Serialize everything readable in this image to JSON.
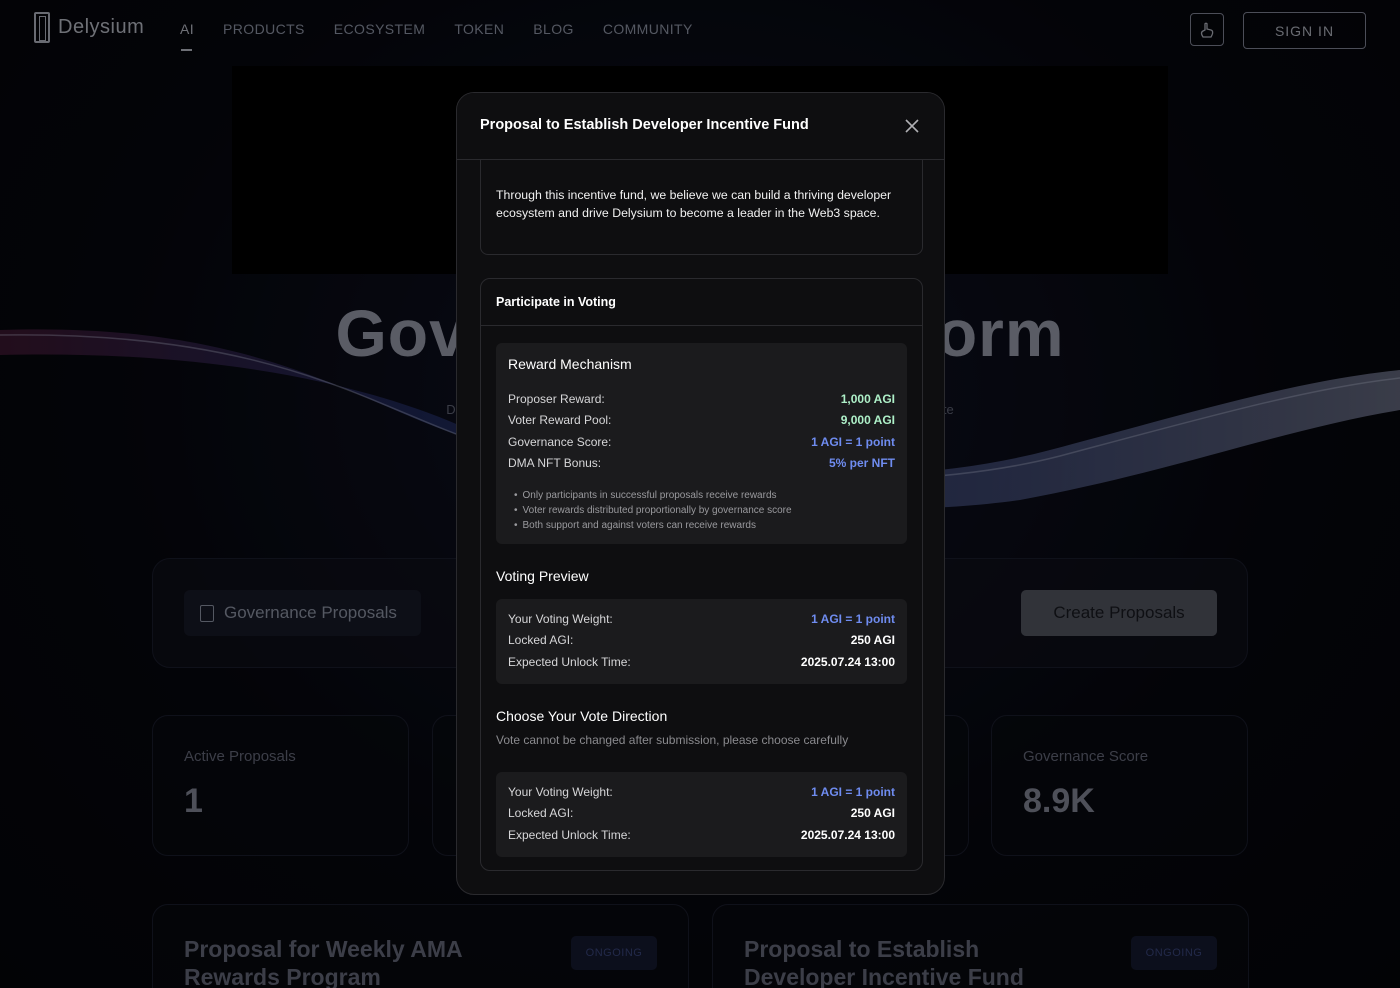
{
  "brand": {
    "name": "Delysium"
  },
  "nav": {
    "links": [
      "AI",
      "PRODUCTS",
      "ECOSYSTEM",
      "TOKEN",
      "BLOG",
      "COMMUNITY"
    ],
    "sign_in": "SIGN IN"
  },
  "hero": {
    "title_left": "Gov",
    "title_right": "orm",
    "sub_left": "De",
    "sub_right": "te"
  },
  "toolbar": {
    "governance_tab": "Governance Proposals",
    "create_button": "Create Proposals"
  },
  "stats": [
    {
      "label": "Active Proposals",
      "value": "1"
    },
    {
      "label": "Governance Score",
      "value": "8.9K"
    }
  ],
  "proposals": [
    {
      "title": "Proposal for Weekly AMA Rewards Program",
      "status": "ONGOING"
    },
    {
      "title": "Proposal to Establish Developer Incentive Fund",
      "status": "ONGOING"
    }
  ],
  "modal": {
    "title": "Proposal to Establish Developer Incentive Fund",
    "description": "Through this incentive fund, we believe we can build a thriving developer ecosystem and drive Delysium to become a leader in the Web3 space.",
    "voting_header": "Participate in Voting",
    "reward": {
      "title": "Reward Mechanism",
      "rows": [
        {
          "label": "Proposer Reward:",
          "value": "1,000 AGI"
        },
        {
          "label": "Voter Reward Pool:",
          "value": "9,000 AGI"
        },
        {
          "label": "Governance Score:",
          "value": "1 AGI = 1 point"
        },
        {
          "label": "DMA NFT Bonus:",
          "value": "5% per NFT"
        }
      ],
      "notes": [
        "Only participants in successful proposals receive rewards",
        "Voter rewards distributed proportionally by governance score",
        "Both support and against voters can receive rewards"
      ]
    },
    "preview": {
      "title": "Voting Preview",
      "rows": [
        {
          "label": "Your Voting Weight:",
          "value": "1 AGI = 1 point"
        },
        {
          "label": "Locked AGI:",
          "value": "250 AGI"
        },
        {
          "label": "Expected Unlock Time:",
          "value": "2025.07.24 13:00"
        }
      ]
    },
    "direction": {
      "title": "Choose Your Vote Direction",
      "subtitle": "Vote cannot be changed after submission, please choose carefully",
      "rows": [
        {
          "label": "Your Voting Weight:",
          "value": "1 AGI = 1 point"
        },
        {
          "label": "Locked AGI:",
          "value": "250 AGI"
        },
        {
          "label": "Expected Unlock Time:",
          "value": "2025.07.24 13:00"
        }
      ]
    }
  },
  "colors": {
    "accent_green": "#aef0c8",
    "accent_blue": "#6f8cf0"
  }
}
